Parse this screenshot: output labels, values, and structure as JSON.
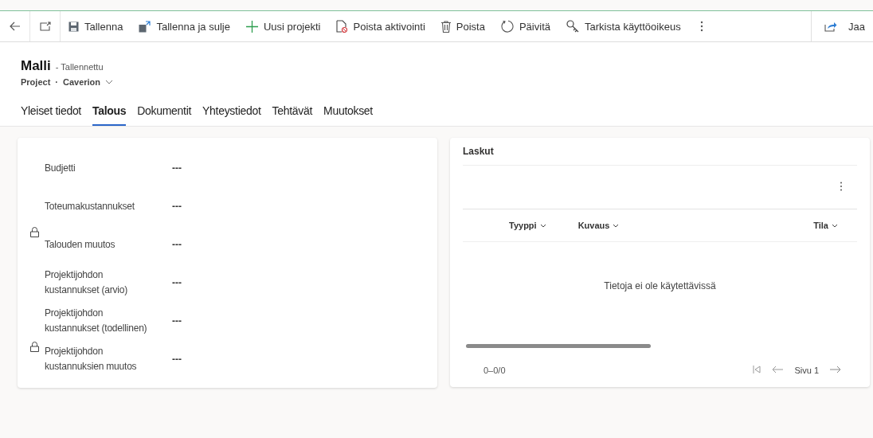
{
  "toolbar": {
    "items": [
      {
        "kind": "save",
        "label": "Tallenna"
      },
      {
        "kind": "save-close",
        "label": "Tallenna ja sulje"
      },
      {
        "kind": "new",
        "label": "Uusi projekti"
      },
      {
        "kind": "deactivate",
        "label": "Poista aktivointi"
      },
      {
        "kind": "delete",
        "label": "Poista"
      },
      {
        "kind": "refresh",
        "label": "Päivitä"
      },
      {
        "kind": "access",
        "label": "Tarkista käyttöoikeus"
      }
    ],
    "share": "Jaa"
  },
  "header": {
    "title": "Malli",
    "status": "- Tallennettu",
    "entity": "Project",
    "separator": "·",
    "owner": "Caverion"
  },
  "tabs": [
    {
      "label": "Yleiset tiedot",
      "selected": false
    },
    {
      "label": "Talous",
      "selected": true
    },
    {
      "label": "Dokumentit",
      "selected": false
    },
    {
      "label": "Yhteystiedot",
      "selected": false
    },
    {
      "label": "Tehtävät",
      "selected": false
    },
    {
      "label": "Muutokset",
      "selected": false
    }
  ],
  "fields": [
    {
      "label": "Budjetti",
      "value": "---",
      "locked": false
    },
    {
      "label": "Toteumakustannukset",
      "value": "---",
      "locked": false
    },
    {
      "label": "Talouden muutos",
      "value": "---",
      "locked": true
    },
    {
      "label": "Projektijohdon kustannukset (arvio)",
      "value": "---",
      "locked": false
    },
    {
      "label": "Projektijohdon kustannukset (todellinen)",
      "value": "---",
      "locked": false
    },
    {
      "label": "Projektijohdon kustannuksien muutos",
      "value": "---",
      "locked": true
    }
  ],
  "invoices": {
    "title": "Laskut",
    "columns": [
      "Tyyppi",
      "Kuvaus",
      "Tila"
    ],
    "empty": "Tietoja ei ole käytettävissä",
    "range": "0–0/0",
    "page": "Sivu 1"
  }
}
